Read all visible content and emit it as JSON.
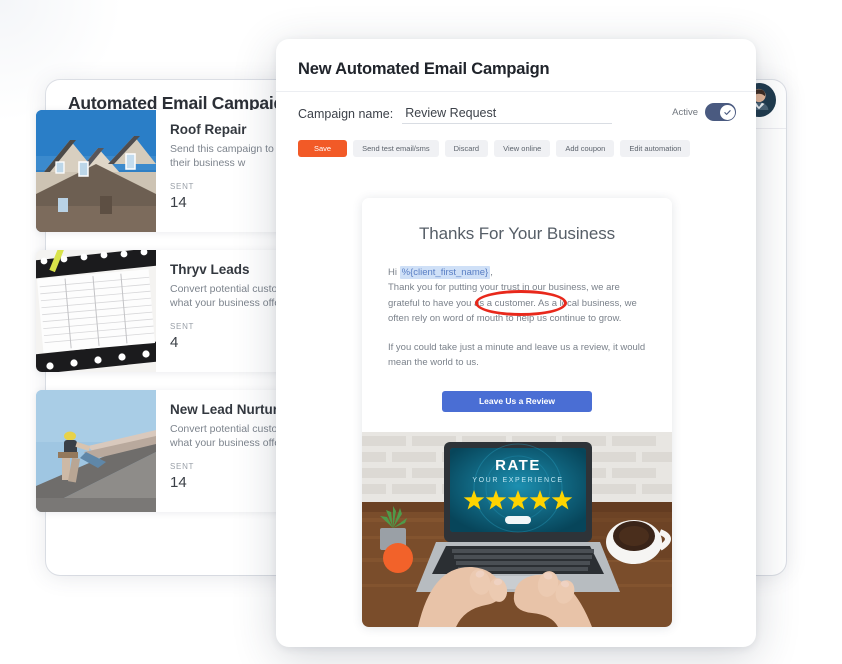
{
  "background_page": {
    "title": "Automated Email Campaigns",
    "avatar": {
      "icon": "user-avatar-photo"
    },
    "campaigns": [
      {
        "name": "Roof Repair",
        "description": "Send this campaign to customers describing their business w",
        "sent_label": "SENT",
        "sent_value": "14",
        "thumbnail": "suburban-houses-rooftops-photo",
        "status_dot": false
      },
      {
        "name": "Thryv Leads",
        "description": "Convert potential customers by describing what your business offers",
        "sent_label": "SENT",
        "sent_value": "4",
        "thumbnail": "notebook-planner-photo",
        "status_dot": true
      },
      {
        "name": "New Lead Nurture",
        "description": "Convert potential customers by describing what your business offers",
        "sent_label": "SENT",
        "sent_value": "14",
        "thumbnail": "roofer-working-on-roof-photo",
        "status_dot": false
      }
    ]
  },
  "modal": {
    "title": "New Automated Email Campaign",
    "campaign_name": {
      "label": "Campaign name:",
      "value": "Review Request",
      "placeholder": "Campaign name"
    },
    "active_toggle": {
      "label": "Active",
      "state": "on",
      "icon": "check-icon",
      "color": "#4a5a80"
    },
    "toolbar": {
      "save": "Save",
      "send_test": "Send test email/sms",
      "discard": "Discard",
      "view_online": "View online",
      "add_coupon": "Add coupon",
      "edit_automation": "Edit automation",
      "save_color": "#f25a27"
    },
    "email_preview": {
      "heading": "Thanks For Your Business",
      "greeting_prefix": "Hi ",
      "merge_token": "%{client_first_name}",
      "greeting_suffix": ",",
      "paragraph_1": "Thank you for putting your trust in our business, we are grateful to have you as a customer. As a local business, we often rely on word of mouth to help us continue to grow.",
      "paragraph_2": "If you could take just a minute and leave us a review, it would mean the world to us.",
      "cta_label": "Leave Us a Review",
      "cta_color": "#4a6ed4",
      "hero_image": {
        "name": "laptop-rate-your-experience-photo",
        "screen_title": "RATE",
        "screen_subtitle": "YOUR EXPERIENCE",
        "stars": 5
      }
    },
    "annotation": {
      "name": "red-ellipse-highlight",
      "target": "merge-token",
      "color": "#e8281b"
    }
  }
}
